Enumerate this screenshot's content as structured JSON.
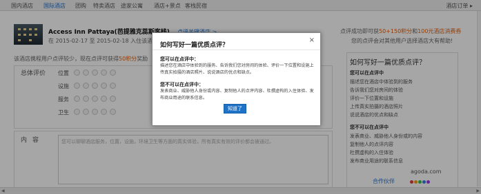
{
  "nav": {
    "items": [
      "国内酒店",
      "国际酒店",
      "团购",
      "特卖酒店",
      "途家公寓",
      "酒店+景点",
      "客栈民宿"
    ],
    "active_index": 1,
    "orders": "酒店订单 ▸"
  },
  "hotel": {
    "name": "Access Inn Pattaya(芭提雅克蕊斯客栈)",
    "stay": "在 2015-02-17 至 2015-02-18 入住该酒店",
    "rating_link": "点评关键酒店 >"
  },
  "reward": {
    "line1_prefix": "点评成功即可获",
    "line1_hl1": "50+150积分",
    "line1_mid": "和",
    "line1_hl2": "100元酒店消费券",
    "line2": "您的点评会对其他用户选择酒店大有帮助!"
  },
  "prompt": {
    "prefix": "该酒店携程用户点评较少，现在点评可获得",
    "highlight": "50积分",
    "suffix": "奖励"
  },
  "rating": {
    "title": "总体评价",
    "rows": [
      "位置",
      "设施",
      "服务",
      "卫生"
    ]
  },
  "content": {
    "label": "内容",
    "placeholder": "您可以聊聊酒店服务，位置，设施，环境卫生等方面的真实体验，所有真实有效的评价都会被通过。"
  },
  "sidebar": {
    "title": "如何写好一篇优质点评？",
    "section1_heading": "您可以在点评中",
    "section1_items": [
      "描述您在酒店中体验到的服务",
      "告诉我们您对房间的体验",
      "评价一下位置和设施",
      "上传真实拍摄的酒店照片",
      "说说酒店的优点和缺点"
    ],
    "section2_heading": "您不可以在点评中",
    "section2_items": [
      "发表商业、威胁他人身份或的内容",
      "复制他人的点评内容",
      "杜撰虚构的入住体验",
      "发布商业用途的联系信息"
    ],
    "agoda": "agoda.com",
    "partners": "合作伙伴"
  },
  "modal": {
    "title": "如何写好一篇优质点评？",
    "close": "×",
    "can_heading": "您可以在点评中：",
    "can_text": "描述您在酒店中体验到的服务、告诉我们您对房间的体验、评价一下位置和设施上传真实拍摄的酒店照片、说说酒店的优点和缺点。",
    "cannot_heading": "您不可以在点评中：",
    "cannot_text": "发表商业、威胁他人身份或内容、复制他人的点评内容、杜撰虚构的入住体验、发布商业用途的联系信息。",
    "ok_label": "知道了"
  },
  "colors": {
    "link_blue": "#1e6fd0",
    "highlight_orange": "#e85a00",
    "button_blue": "#1e73c9"
  }
}
